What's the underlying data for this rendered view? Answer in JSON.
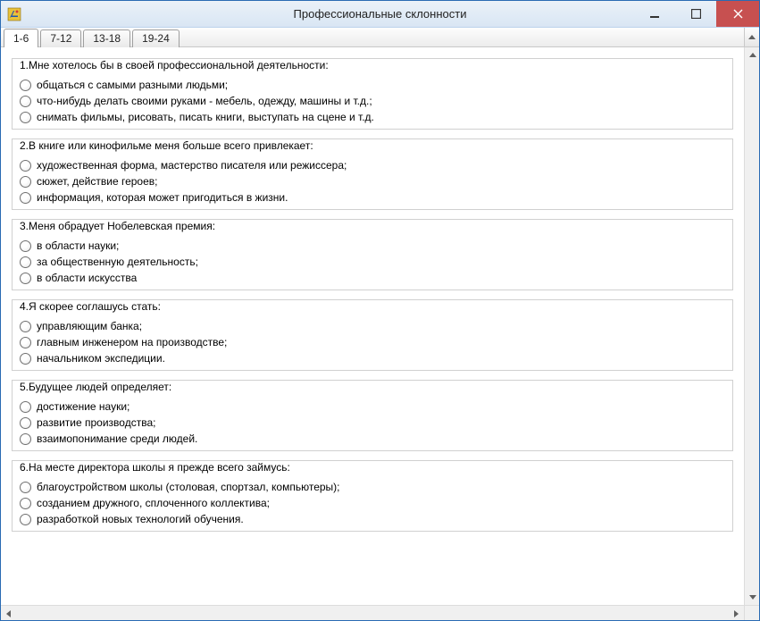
{
  "window": {
    "title": "Профессиональные склонности"
  },
  "tabs": [
    {
      "label": "1-6",
      "active": true
    },
    {
      "label": "7-12",
      "active": false
    },
    {
      "label": "13-18",
      "active": false
    },
    {
      "label": "19-24",
      "active": false
    }
  ],
  "questions": [
    {
      "title": "1.Мне хотелось бы в своей профессиональной деятельности:",
      "options": [
        "общаться с самыми разными людьми;",
        "что-нибудь делать своими руками - мебель, одежду, машины и т.д.;",
        "снимать фильмы, рисовать, писать книги, выступать на сцене и т.д."
      ]
    },
    {
      "title": "2.В книге или кинофильме меня больше всего привлекает:",
      "options": [
        "художественная форма, мастерство писателя или режиссера;",
        "сюжет, действие героев;",
        "информация, которая может пригодиться в жизни."
      ]
    },
    {
      "title": "3.Меня обрадует Нобелевская премия:",
      "options": [
        "в области науки;",
        "за общественную деятельность;",
        "в области искусства"
      ]
    },
    {
      "title": "4.Я скорее соглашусь стать:",
      "options": [
        "управляющим банка;",
        "главным инженером на производстве;",
        "начальником экспедиции."
      ]
    },
    {
      "title": "5.Будущее людей определяет:",
      "options": [
        "достижение науки;",
        "развитие производства;",
        "взаимопонимание среди людей."
      ]
    },
    {
      "title": "6.На месте директора школы я прежде всего займусь:",
      "options": [
        "благоустройством школы (столовая, спортзал, компьютеры);",
        "созданием дружного, сплоченного коллектива;",
        "разработкой новых технологий обучения."
      ]
    }
  ]
}
